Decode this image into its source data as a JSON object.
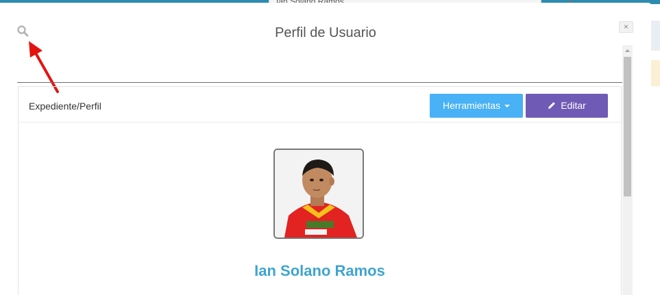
{
  "background": {
    "tab_text": "Ian Solano Ramos"
  },
  "modal": {
    "title": "Perfil de Usuario",
    "close_label": "×"
  },
  "panel": {
    "breadcrumb": "Expediente/Perfil",
    "tools_button": "Herramientas",
    "edit_button": "Editar"
  },
  "profile": {
    "name": "Ian Solano Ramos"
  },
  "icons": {
    "search": "search-icon",
    "pencil": "pencil-icon",
    "caret": "caret-down-icon",
    "annotation": "red-arrow"
  },
  "colors": {
    "tools_button": "#49b1f5",
    "edit_button": "#6f5bb5",
    "name_text": "#3fa4d1",
    "arrow": "#e3140f"
  }
}
